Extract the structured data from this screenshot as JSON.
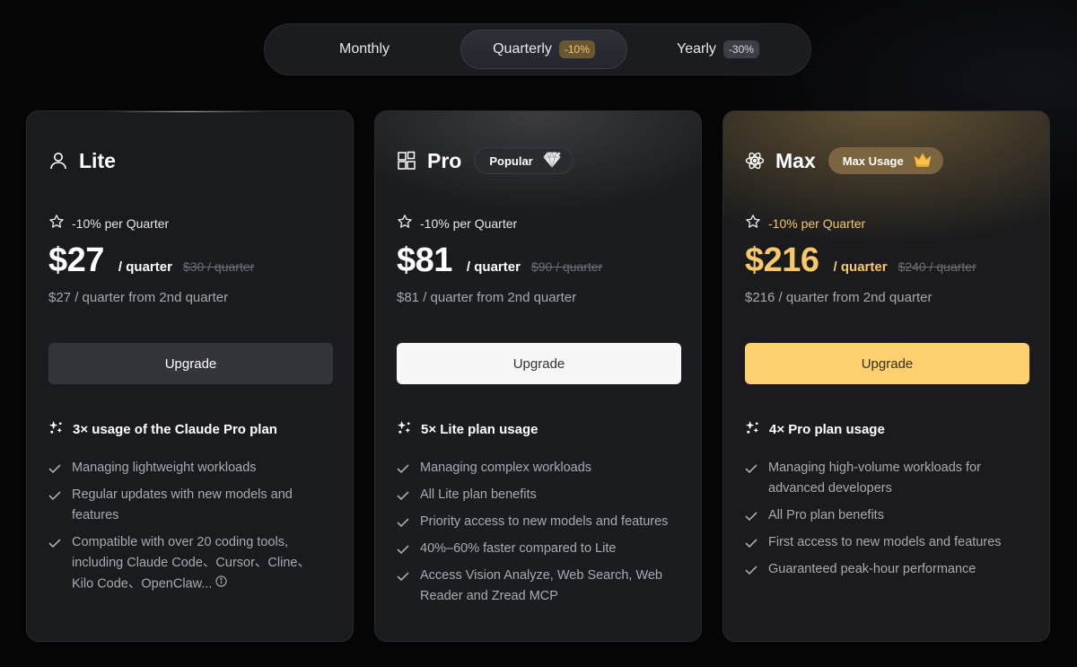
{
  "billing_toggle": {
    "options": [
      {
        "label": "Monthly",
        "badge": ""
      },
      {
        "label": "Quarterly",
        "badge": "-10%"
      },
      {
        "label": "Yearly",
        "badge": "-30%"
      }
    ],
    "selected": "Quarterly"
  },
  "plans": [
    {
      "name": "Lite",
      "icon": "user-icon",
      "badge": "",
      "promo": "-10% per Quarter",
      "price": "$27",
      "period": "/ quarter",
      "original_price": "$30 / quarter",
      "renewal": "$27 / quarter from 2nd quarter",
      "button": "Upgrade",
      "headline": "3× usage of the Claude Pro plan",
      "features": [
        "Managing lightweight workloads",
        "Regular updates with new models and features",
        "Compatible with over 20 coding tools, including Claude Code、Cursor、Cline、Kilo Code、OpenClaw..."
      ]
    },
    {
      "name": "Pro",
      "icon": "blocks-icon",
      "badge": "Popular",
      "badge_icon": "diamond-icon",
      "promo": "-10% per Quarter",
      "price": "$81",
      "period": "/ quarter",
      "original_price": "$90 / quarter",
      "renewal": "$81 / quarter from 2nd quarter",
      "button": "Upgrade",
      "headline": "5× Lite plan usage",
      "features": [
        "Managing complex workloads",
        "All Lite plan benefits",
        "Priority access to new models and features",
        "40%–60% faster compared to Lite",
        "Access Vision Analyze, Web Search, Web Reader and Zread MCP"
      ]
    },
    {
      "name": "Max",
      "icon": "atom-icon",
      "badge": "Max Usage",
      "badge_icon": "crown-icon",
      "promo": "-10% per Quarter",
      "price": "$216",
      "period": "/ quarter",
      "original_price": "$240 / quarter",
      "renewal": "$216 / quarter from 2nd quarter",
      "button": "Upgrade",
      "headline": "4× Pro plan usage",
      "features": [
        "Managing high-volume workloads for advanced developers",
        "All Pro plan benefits",
        "First access to new models and features",
        "Guaranteed peak-hour performance"
      ]
    }
  ],
  "colors": {
    "accent_gold": "#fcd06e",
    "background": "#050506",
    "card": "#1a1b1e"
  }
}
